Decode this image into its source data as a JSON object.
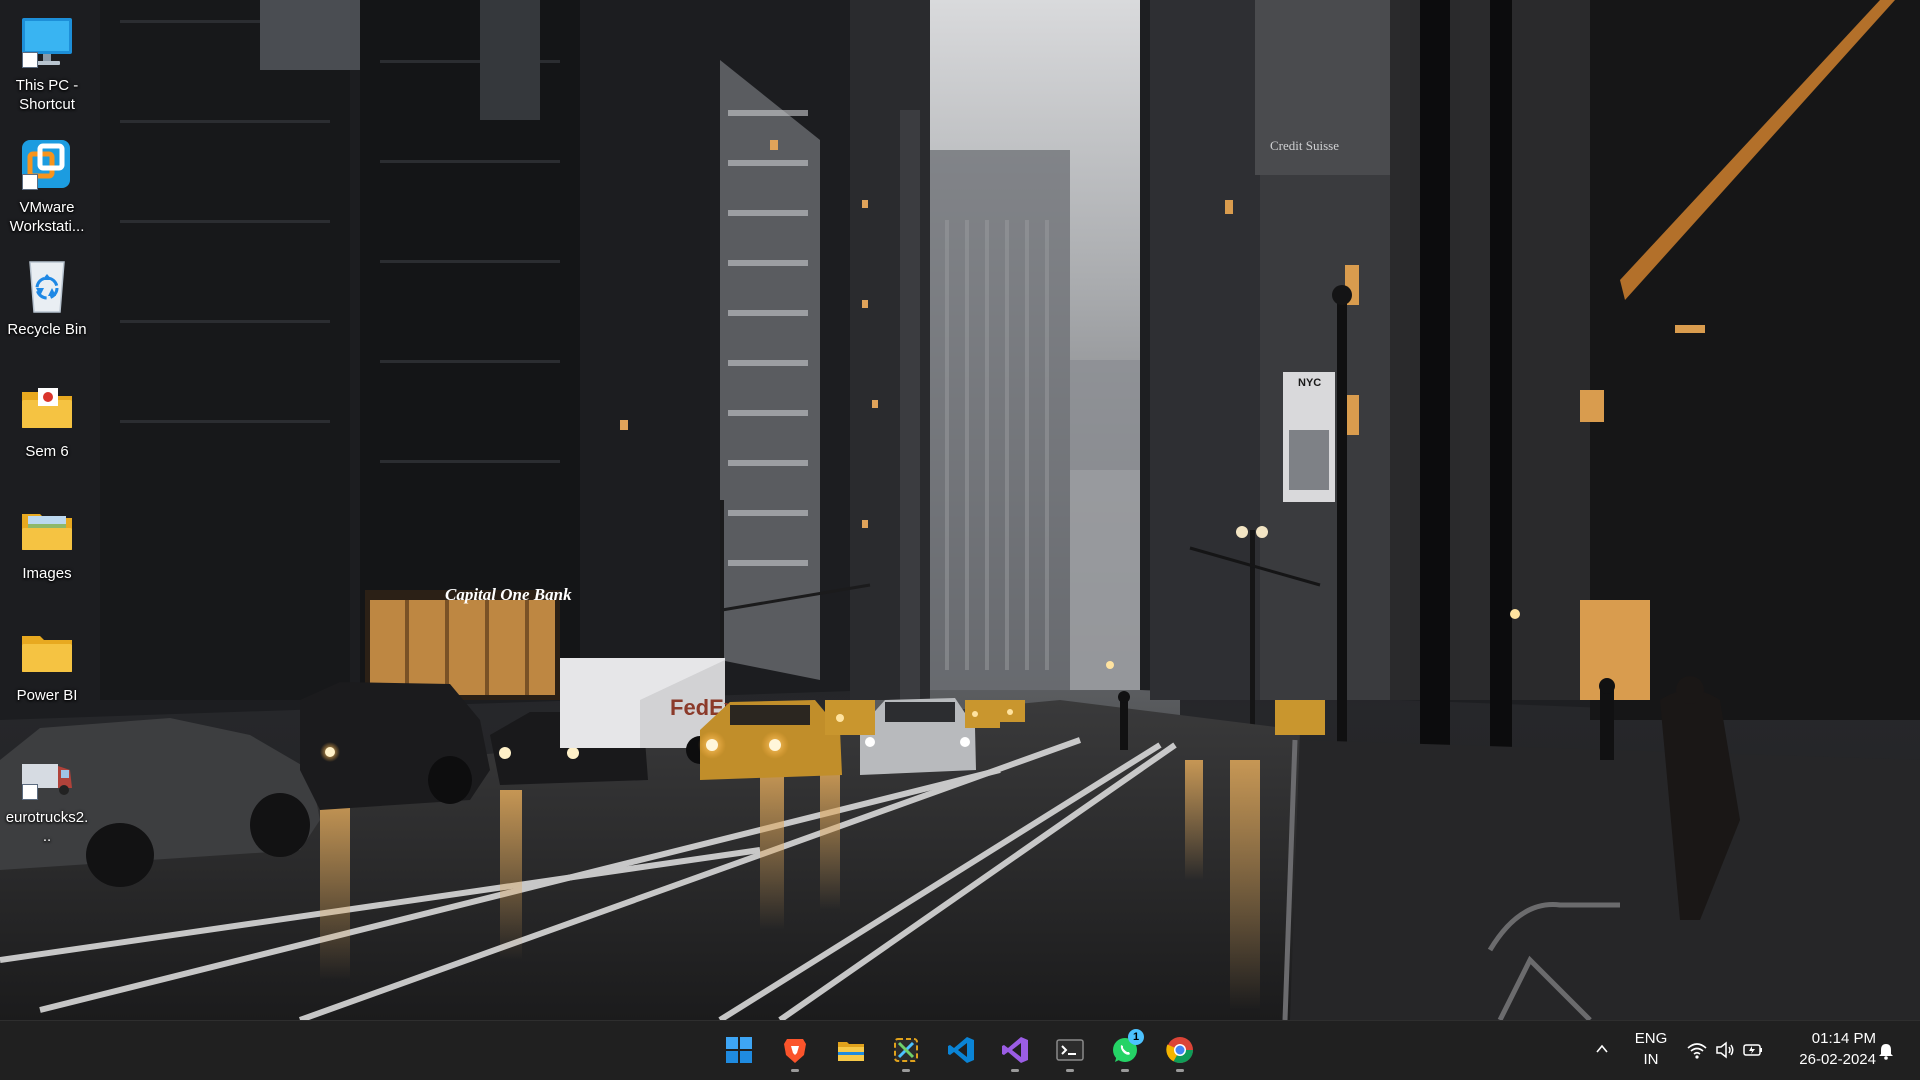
{
  "desktop": {
    "icons": [
      {
        "label": "This PC - Shortcut",
        "icon": "monitor-icon"
      },
      {
        "label": "VMware Workstati...",
        "icon": "vmware-icon"
      },
      {
        "label": "Recycle Bin",
        "icon": "recycle-bin-icon"
      },
      {
        "label": "Sem 6",
        "icon": "folder-icon"
      },
      {
        "label": "Images",
        "icon": "folder-icon"
      },
      {
        "label": "Power BI",
        "icon": "folder-icon"
      },
      {
        "label": "eurotrucks2...",
        "icon": "truck-icon"
      }
    ]
  },
  "wallpaper": {
    "signs": {
      "bank": "Capital One Bank",
      "truck": "FedEx",
      "banner": "NYC",
      "billboard": "Credit Suisse"
    }
  },
  "taskbar": {
    "apps": [
      {
        "name": "Start",
        "icon": "windows-start-icon",
        "running": false
      },
      {
        "name": "Brave",
        "icon": "brave-icon",
        "running": true
      },
      {
        "name": "File Explorer",
        "icon": "file-explorer-icon",
        "running": false
      },
      {
        "name": "Snipping Tool",
        "icon": "snipping-tool-icon",
        "running": true
      },
      {
        "name": "Visual Studio Code",
        "icon": "vscode-icon",
        "running": false
      },
      {
        "name": "Visual Studio",
        "icon": "visual-studio-icon",
        "running": true
      },
      {
        "name": "Terminal",
        "icon": "terminal-icon",
        "running": true
      },
      {
        "name": "WhatsApp",
        "icon": "whatsapp-icon",
        "running": true,
        "badge": "1"
      },
      {
        "name": "Chrome",
        "icon": "chrome-icon",
        "running": true
      }
    ],
    "tray": {
      "language": "ENG",
      "region": "IN",
      "time": "01:14 PM",
      "date": "26-02-2024"
    }
  },
  "colors": {
    "taskbar_bg": "#202020",
    "accent": "#4cc2ff",
    "folder_yellow": "#f5c342"
  }
}
